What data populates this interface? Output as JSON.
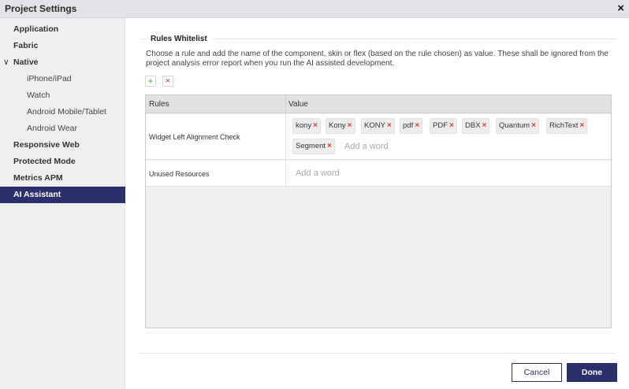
{
  "window": {
    "title": "Project Settings",
    "close_icon": "×"
  },
  "sidebar": {
    "items": [
      {
        "label": "Application"
      },
      {
        "label": "Fabric"
      },
      {
        "label": "Native",
        "chevron": "∨"
      },
      {
        "label": "iPhone/iPad"
      },
      {
        "label": "Watch"
      },
      {
        "label": "Android Mobile/Tablet"
      },
      {
        "label": "Android Wear"
      },
      {
        "label": "Responsive Web"
      },
      {
        "label": "Protected Mode"
      },
      {
        "label": "Metrics APM"
      },
      {
        "label": "AI Assistant",
        "active": true
      }
    ]
  },
  "section": {
    "legend": "Rules Whitelist",
    "description": "Choose a rule and add the name of the component, skin or flex (based on the rule chosen) as value. These shall be ignored from the project analysis error report when you run the AI assisted development."
  },
  "toolbar": {
    "add_label": "+",
    "remove_label": "×"
  },
  "table": {
    "headers": [
      "Rules",
      "Value"
    ],
    "rows": [
      {
        "rule": "Widget Left Alignment Check",
        "values": [
          "kony",
          "Kony",
          "KONY",
          "pdf",
          "PDF",
          "DBX",
          "Quantum",
          "RichText",
          "Segment"
        ],
        "placeholder": "Add a word"
      },
      {
        "rule": "Unused Resources",
        "values": [],
        "placeholder": "Add a word"
      }
    ],
    "remove_tag_icon": "×"
  },
  "footer": {
    "cancel_label": "Cancel",
    "done_label": "Done"
  },
  "colors": {
    "accent": "#2b2f6b",
    "remove": "#e23b3b",
    "add": "#3bb34a"
  }
}
